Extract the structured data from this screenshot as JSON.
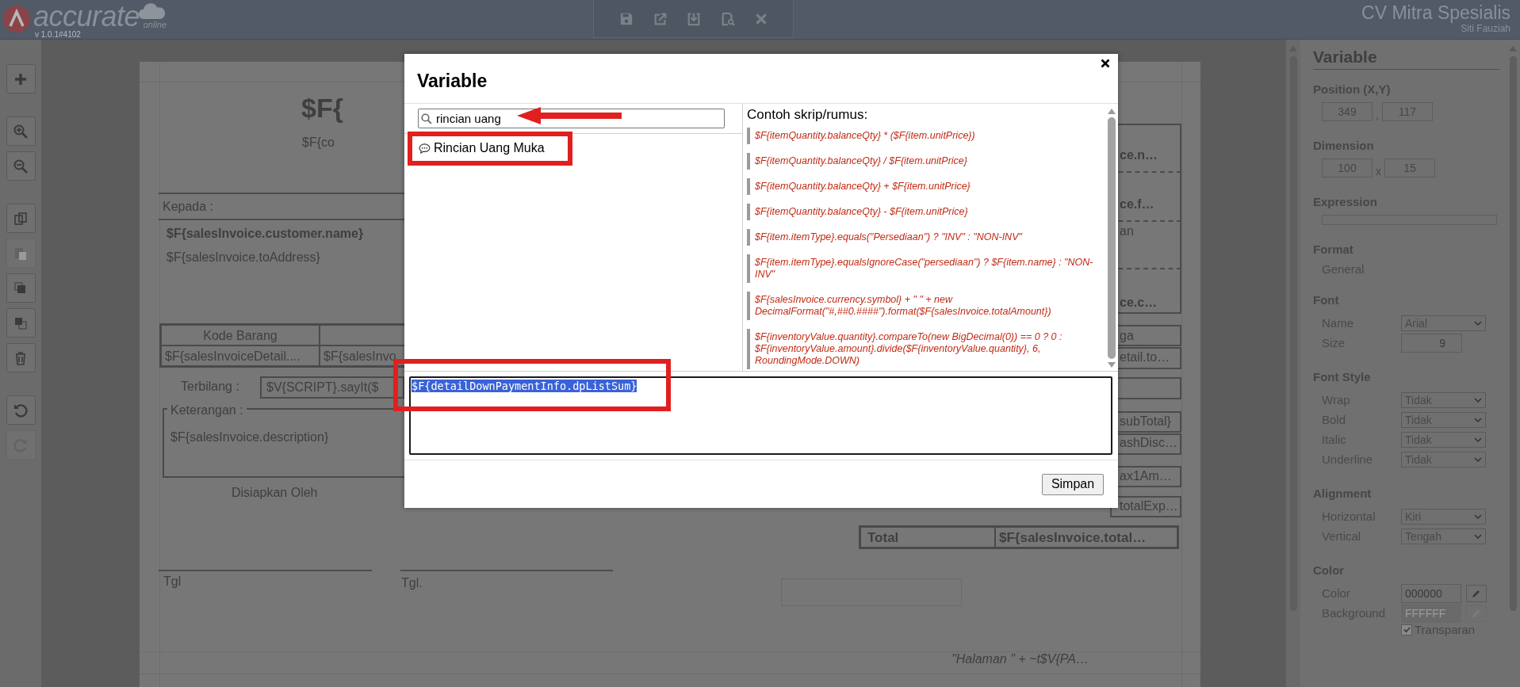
{
  "app_header": {
    "logo_text": "accurate",
    "logo_suffix": "online",
    "version": "v 1.0.1#4102",
    "company": "CV Mitra Spesialis",
    "user": "Siti Fauziah"
  },
  "tools": [
    {
      "kind": "add",
      "disabled": false
    },
    {
      "kind": "zoom-in",
      "disabled": false
    },
    {
      "kind": "zoom-out",
      "disabled": false
    },
    {
      "kind": "copy",
      "disabled": false
    },
    {
      "kind": "paste",
      "disabled": true
    },
    {
      "kind": "bring-front",
      "disabled": false
    },
    {
      "kind": "send-back",
      "disabled": false
    },
    {
      "kind": "delete",
      "disabled": false
    },
    {
      "kind": "undo",
      "disabled": false
    },
    {
      "kind": "redo",
      "disabled": true
    }
  ],
  "report_canvas": {
    "title_fragment": "$F{",
    "subtitle_fragment": "$F{co",
    "to_label": "Kepada :",
    "customer_name": "$F{salesInvoice.customer.name}",
    "to_address": "$F{salesInvoice.toAddress}",
    "table_header": "Kode Barang",
    "table_row": [
      "$F{salesInvoiceDetail....",
      "$F{salesInvo"
    ],
    "amount_words_label": "Terbilang :",
    "amount_words": "$V{SCRIPT}.sayIt($",
    "notes_label": "Keterangan :",
    "notes": "$F{salesInvoice.description}",
    "prepared_by": "Disiapkan Oleh",
    "date_labels": [
      "Tgl",
      "Tgl."
    ],
    "right_fragments": [
      "ce.n…",
      "ce.f…",
      "an",
      "ce.c…",
      "ga",
      "etail.to…",
      "subTotal}",
      "ashDisc…",
      "ax1Am…",
      "totalExp…"
    ],
    "total_label": "Total",
    "total_value": "$F{salesInvoice.total…",
    "footer": "\"Halaman \" +  ~t$V{PA…"
  },
  "properties_panel": {
    "title": "Variable",
    "sections": [
      {
        "heading": "Position (X,Y)",
        "rows": [
          {
            "kind": "pair",
            "values": [
              "349",
              "117"
            ],
            "separator": ","
          }
        ]
      },
      {
        "heading": "Dimension",
        "rows": [
          {
            "kind": "pair",
            "values": [
              "100",
              "15"
            ],
            "separator": "x"
          }
        ]
      },
      {
        "heading": "Expression",
        "rows": [
          {
            "kind": "bar"
          }
        ]
      },
      {
        "heading": "Format",
        "rows": [
          {
            "kind": "text",
            "value": "General"
          }
        ]
      },
      {
        "heading": "Font",
        "rows": [
          {
            "kind": "select",
            "label": "Name",
            "value": "Arial"
          },
          {
            "kind": "input",
            "label": "Size",
            "value": "9"
          }
        ]
      },
      {
        "heading": "Font Style",
        "rows": [
          {
            "kind": "select",
            "label": "Wrap",
            "value": "Tidak"
          },
          {
            "kind": "select",
            "label": "Bold",
            "value": "Tidak"
          },
          {
            "kind": "select",
            "label": "Italic",
            "value": "Tidak"
          },
          {
            "kind": "select",
            "label": "Underline",
            "value": "Tidak"
          }
        ]
      },
      {
        "heading": "Alignment",
        "rows": [
          {
            "kind": "select",
            "label": "Horizontal",
            "value": "Kiri"
          },
          {
            "kind": "select",
            "label": "Vertical",
            "value": "Tengah"
          }
        ]
      },
      {
        "heading": "Color",
        "rows": [
          {
            "kind": "color",
            "label": "Color",
            "value": "000000",
            "disabled": false
          },
          {
            "kind": "color",
            "label": "Background",
            "value": "FFFFFF",
            "disabled": true
          },
          {
            "kind": "checkbox",
            "label": "Transparan",
            "checked": true
          }
        ]
      }
    ]
  },
  "dialog": {
    "title": "Variable",
    "search": {
      "value": "rincian uang"
    },
    "results": [
      {
        "label": "Rincian Uang Muka",
        "selected": false
      }
    ],
    "examples_heading": "Contoh skrip/rumus:",
    "examples": [
      "$F{itemQuantity.balanceQty} * ($F{item.unitPrice})",
      "$F{itemQuantity.balanceQty} / $F{item.unitPrice}",
      "$F{itemQuantity.balanceQty} + $F{item.unitPrice}",
      "$F{itemQuantity.balanceQty} - $F{item.unitPrice}",
      "$F{item.itemType}.equals(\"Persediaan\") ? \"INV\" : \"NON-INV\"",
      "$F{item.itemType}.equalsIgnoreCase(\"persediaan\") ? $F{item.name} : \"NON-INV\"",
      "$F{salesInvoice.currency.symbol} + \" \" + new DecimalFormat(\"#,##0.####\").format($F{salesInvoice.totalAmount})",
      "$F{inventoryValue.quantity}.compareTo(new BigDecimal(0)) == 0 ? 0 : $F{inventoryValue.amount}.divide($F{inventoryValue.quantity}, 6, RoundingMode.DOWN)"
    ],
    "expression": {
      "value": "$F{detailDownPaymentInfo.dpListSum}",
      "highlighted": true
    },
    "save_button": "Simpan"
  }
}
